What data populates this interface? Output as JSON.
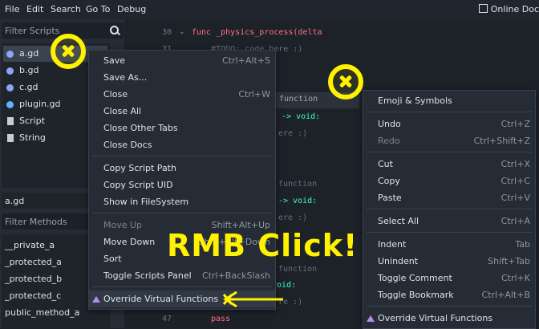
{
  "menubar": {
    "items": [
      "File",
      "Edit",
      "Search",
      "Go To",
      "Debug"
    ],
    "online_docs": "Online Doc"
  },
  "left_panel": {
    "filter_scripts_placeholder": "Filter Scripts",
    "scripts": [
      "a.gd",
      "b.gd",
      "c.gd",
      "plugin.gd",
      "Script",
      "String"
    ],
    "current_file": "a.gd",
    "filter_methods_placeholder": "Filter Methods",
    "methods": [
      "__private_a",
      "_protected_a",
      "_protected_b",
      "_protected_c",
      "public_method_a"
    ]
  },
  "code": {
    "line_30_num": "30",
    "line_30": "func _physics_process(delta",
    "line_31_num": "31",
    "line_31": "#TODO: code here :)",
    "tab_label": "function",
    "frag_void1": ") -> void:",
    "frag_here1": "ere :)",
    "frag_function2": "function",
    "frag_void2": "-> void:",
    "frag_here2": "ere :)",
    "frag_function3": "function",
    "frag_void3": "void:",
    "frag_here3": "re :)",
    "line_47_num": "47",
    "line_47": "pass"
  },
  "script_context_menu": {
    "items": [
      {
        "label": "Save",
        "shortcut": "Ctrl+Alt+S"
      },
      {
        "label": "Save As...",
        "shortcut": ""
      },
      {
        "label": "Close",
        "shortcut": "Ctrl+W"
      },
      {
        "label": "Close All",
        "shortcut": ""
      },
      {
        "label": "Close Other Tabs",
        "shortcut": ""
      },
      {
        "label": "Close Docs",
        "shortcut": ""
      },
      {
        "label": "Copy Script Path",
        "shortcut": ""
      },
      {
        "label": "Copy Script UID",
        "shortcut": ""
      },
      {
        "label": "Show in FileSystem",
        "shortcut": ""
      },
      {
        "label": "Move Up",
        "shortcut": "Shift+Alt+Up"
      },
      {
        "label": "Move Down",
        "shortcut": "Shift+Alt+Down"
      },
      {
        "label": "Sort",
        "shortcut": ""
      },
      {
        "label": "Toggle Scripts Panel",
        "shortcut": "Ctrl+BackSlash"
      },
      {
        "label": "Override Virtual Functions",
        "shortcut": ""
      }
    ]
  },
  "editor_context_menu": {
    "items": [
      {
        "label": "Emoji & Symbols",
        "shortcut": ""
      },
      {
        "label": "Undo",
        "shortcut": "Ctrl+Z"
      },
      {
        "label": "Redo",
        "shortcut": "Ctrl+Shift+Z"
      },
      {
        "label": "Cut",
        "shortcut": "Ctrl+X"
      },
      {
        "label": "Copy",
        "shortcut": "Ctrl+C"
      },
      {
        "label": "Paste",
        "shortcut": "Ctrl+V"
      },
      {
        "label": "Select All",
        "shortcut": "Ctrl+A"
      },
      {
        "label": "Indent",
        "shortcut": "Tab"
      },
      {
        "label": "Unindent",
        "shortcut": "Shift+Tab"
      },
      {
        "label": "Toggle Comment",
        "shortcut": "Ctrl+K"
      },
      {
        "label": "Toggle Bookmark",
        "shortcut": "Ctrl+Alt+B"
      },
      {
        "label": "Override Virtual Functions",
        "shortcut": ""
      }
    ]
  },
  "overlay": {
    "caption": "RMB Click!"
  },
  "colors": {
    "accent_yellow": "#fff200",
    "virtual_icon": "#b58cf0",
    "keyword": "#ff7085"
  }
}
